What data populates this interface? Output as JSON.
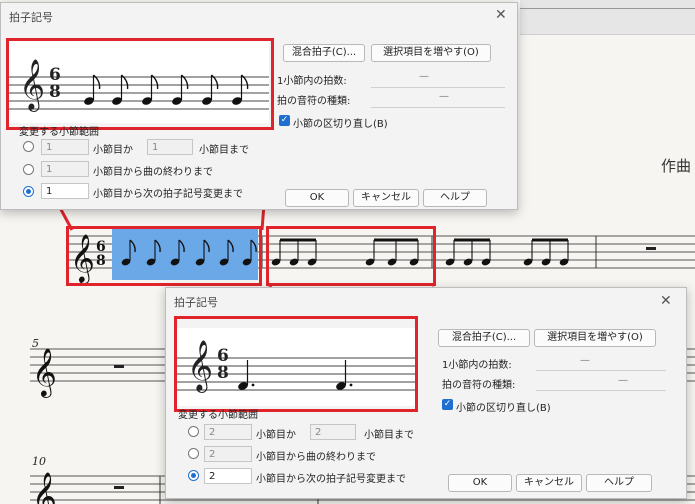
{
  "score": {
    "composer": "作曲",
    "measure_numbers": [
      "5",
      "10"
    ]
  },
  "dialog1": {
    "title": "拍子記号",
    "btn_compound": "混合拍子(C)...",
    "btn_add": "選択項目を増やす(O)",
    "beats_label": "1小節内の拍数:",
    "beats_value": "—",
    "unit_label": "拍の音符の種類:",
    "unit_value": "—",
    "rebar_label": "小節の区切り直し(B)",
    "range_label": "変更する小節範囲",
    "from_value": "1",
    "to_value": "1",
    "from_to_a": "小節目か",
    "from_to_b": "小節目まで",
    "to_end_value": "1",
    "to_end_label": "小節目から曲の終わりまで",
    "to_next_value": "1",
    "to_next_label": "小節目から次の拍子記号変更まで",
    "ok": "OK",
    "cancel": "キャンセル",
    "help": "ヘルプ"
  },
  "dialog2": {
    "title": "拍子記号",
    "btn_compound": "混合拍子(C)...",
    "btn_add": "選択項目を増やす(O)",
    "beats_label": "1小節内の拍数:",
    "beats_value": "—",
    "unit_label": "拍の音符の種類:",
    "unit_value": "—",
    "rebar_label": "小節の区切り直し(B)",
    "range_label": "変更する小節範囲",
    "from_value": "2",
    "to_value": "2",
    "from_to_a": "小節目か",
    "from_to_b": "小節目まで",
    "to_end_value": "2",
    "to_end_label": "小節目から曲の終わりまで",
    "to_next_value": "2",
    "to_next_label": "小節目から次の拍子記号変更まで",
    "ok": "OK",
    "cancel": "キャンセル",
    "help": "ヘルプ"
  },
  "time_signature": {
    "numerator": "6",
    "denominator": "8"
  },
  "glyphs": {
    "treble_clef": "𝄞"
  },
  "colors": {
    "highlight": "#6aa8e8",
    "accent": "#1f6fd1",
    "annotation": "#e0242b"
  }
}
